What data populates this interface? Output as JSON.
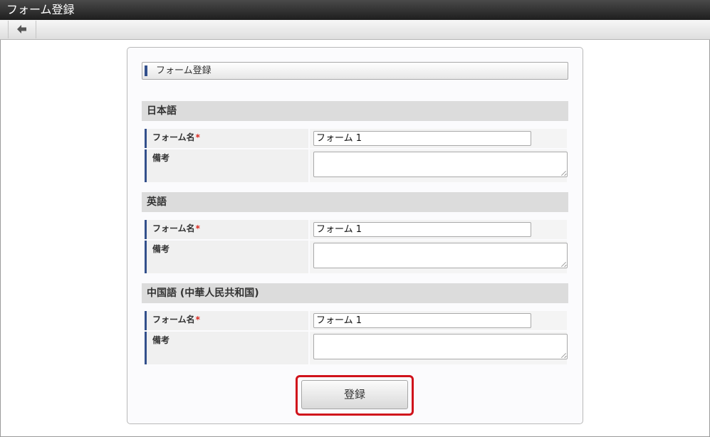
{
  "window": {
    "title": "フォーム登録"
  },
  "toolbar": {
    "back_icon": "arrow-left-icon"
  },
  "form": {
    "header": "フォーム登録",
    "sections": [
      {
        "heading": "日本語",
        "name_label": "フォーム名",
        "required_mark": "*",
        "name_value": "フォーム 1",
        "remarks_label": "備考",
        "remarks_value": ""
      },
      {
        "heading": "英語",
        "name_label": "フォーム名",
        "required_mark": "*",
        "name_value": "フォーム 1",
        "remarks_label": "備考",
        "remarks_value": ""
      },
      {
        "heading": "中国語 (中華人民共和国)",
        "name_label": "フォーム名",
        "required_mark": "*",
        "name_value": "フォーム 1",
        "remarks_label": "備考",
        "remarks_value": ""
      }
    ],
    "submit_label": "登録"
  },
  "colors": {
    "accent": "#33508c",
    "required": "#d9261c",
    "highlight": "#d0121b"
  }
}
